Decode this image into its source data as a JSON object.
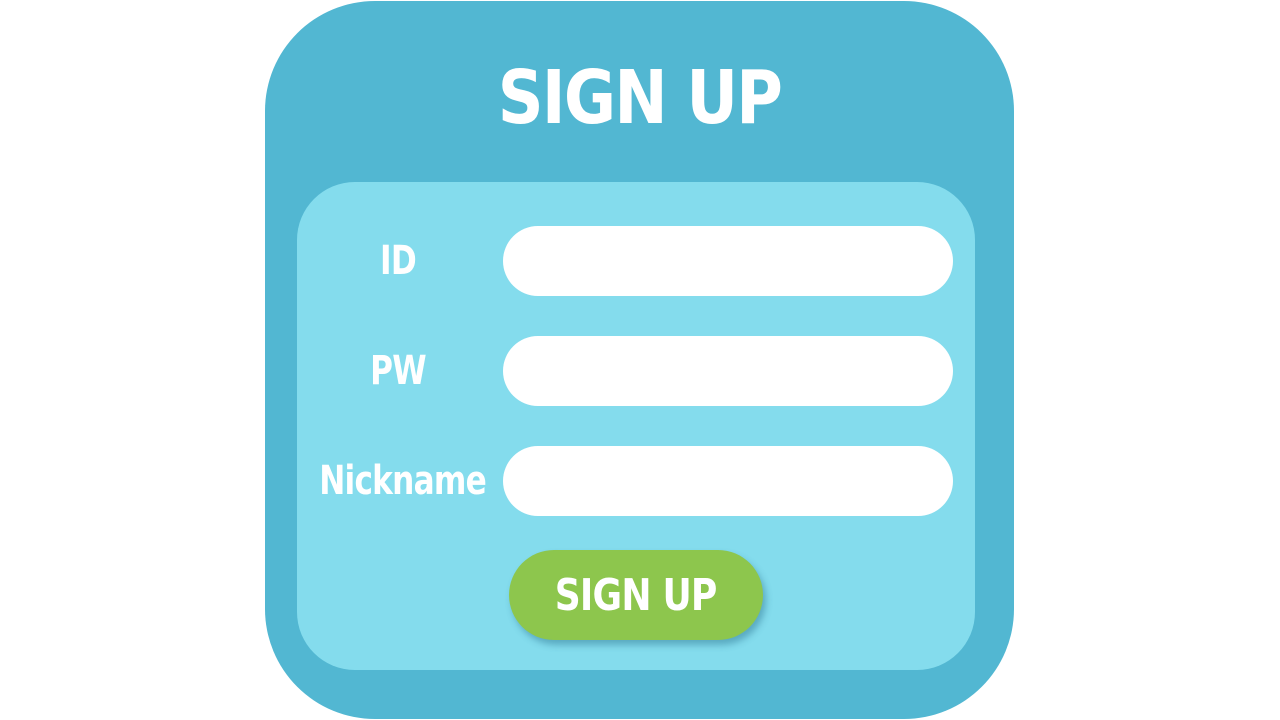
{
  "form": {
    "title": "SIGN UP",
    "fields": [
      {
        "label": "ID",
        "value": "",
        "placeholder": ""
      },
      {
        "label": "PW",
        "value": "",
        "placeholder": ""
      },
      {
        "label": "Nickname",
        "value": "",
        "placeholder": ""
      }
    ],
    "submit_label": "SIGN UP"
  },
  "colors": {
    "panel": "#52b7d2",
    "inner_panel": "#84dced",
    "field_background": "#ffffff",
    "button": "#8dc64d",
    "text": "#ffffff"
  }
}
